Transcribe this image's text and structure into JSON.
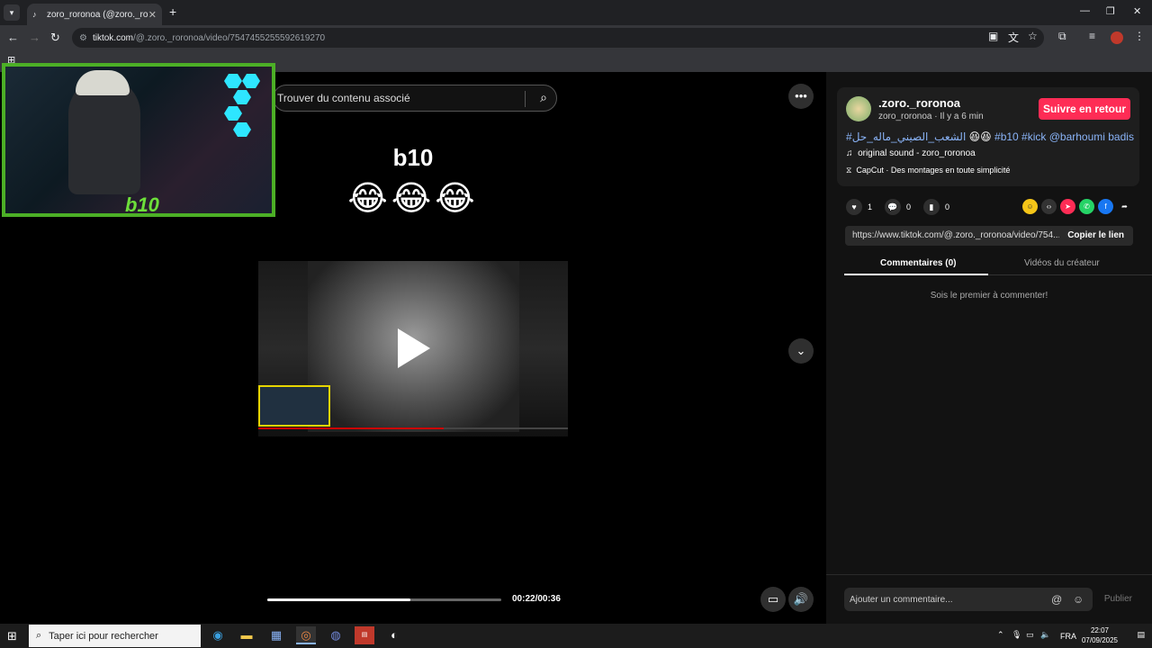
{
  "browser": {
    "tab_title": "zoro_roronoa (@zoro._roronoa",
    "url_host": "tiktok.com",
    "url_path": "/@.zoro._roronoa/video/7547455255592619270"
  },
  "video": {
    "search_placeholder": "Trouver du contenu associé",
    "caption_text": "b10",
    "caption_emojis": "😂😂😂",
    "time": "00:22/00:36",
    "progress": 0.61
  },
  "author": {
    "username": ".zoro._roronoa",
    "nick_time": "zoro_roronoa · Il y a 6 min",
    "follow_label": "Suivre en retour",
    "desc_hashtag_ar": "#الشعب_الصيني_ماله_حل",
    "desc_emojis": "😆😆",
    "desc_tags": "#b10 #kick @barhoumi badis",
    "music": "original sound - zoro_roronoa",
    "capcut": "CapCut · Des montages en toute simplicité"
  },
  "actions": {
    "likes": "1",
    "comments": "0",
    "saves": "0"
  },
  "link": {
    "url": "https://www.tiktok.com/@.zoro._roronoa/video/754...",
    "copy_label": "Copier le lien"
  },
  "tabs": {
    "comments": "Commentaires (0)",
    "creator_videos": "Vidéos du créateur"
  },
  "empty_comments": "Sois le premier à commenter!",
  "composer": {
    "placeholder": "Ajouter un commentaire...",
    "publish": "Publier"
  },
  "taskbar": {
    "search_placeholder": "Taper ici pour rechercher",
    "lang": "FRA",
    "time": "22:07",
    "date": "07/09/2025"
  },
  "webcam": {
    "logo_text": "b10"
  },
  "colors": {
    "accent": "#fe2c55",
    "link": "#8ab4f8",
    "webcam_border": "#4caf26"
  }
}
